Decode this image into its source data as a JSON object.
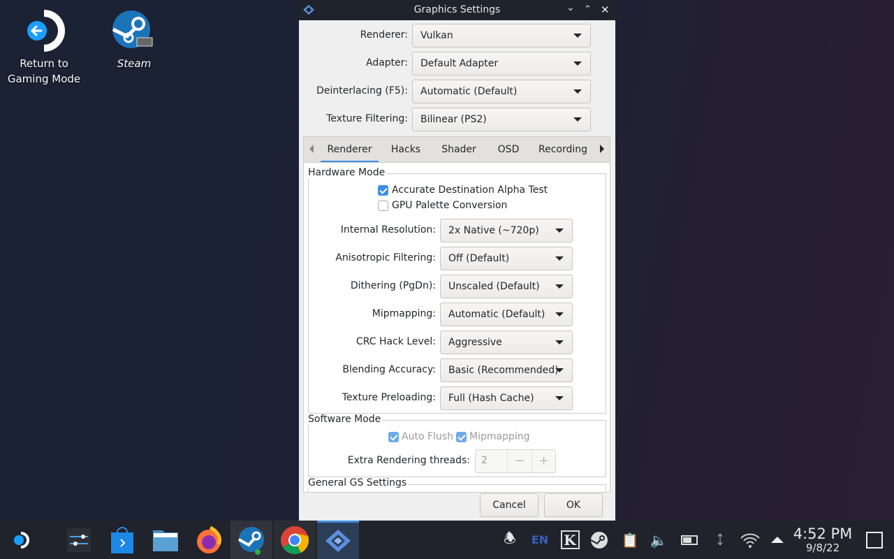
{
  "desktop": {
    "icons": [
      {
        "label_line1": "Return to",
        "label_line2": "Gaming Mode",
        "icon": "return-gaming-mode-icon"
      },
      {
        "label_line1": "Steam",
        "icon": "steam-icon"
      }
    ]
  },
  "window": {
    "title": "Graphics Settings",
    "app_icon": "pcsx2-icon",
    "controls": [
      "minimize-icon",
      "maximize-icon",
      "close-icon"
    ],
    "top_fields": [
      {
        "label": "Renderer:",
        "value": "Vulkan"
      },
      {
        "label": "Adapter:",
        "value": "Default Adapter"
      },
      {
        "label": "Deinterlacing (F5):",
        "value": "Automatic (Default)"
      },
      {
        "label": "Texture Filtering:",
        "value": "Bilinear (PS2)"
      }
    ],
    "tabs": [
      {
        "label": "Renderer",
        "active": true
      },
      {
        "label": "Hacks"
      },
      {
        "label": "Shader"
      },
      {
        "label": "OSD"
      },
      {
        "label": "Recording"
      }
    ],
    "hardware_mode": {
      "title": "Hardware Mode",
      "checkboxes": [
        {
          "label": "Accurate Destination Alpha Test",
          "checked": true
        },
        {
          "label": "GPU Palette Conversion",
          "checked": false
        }
      ],
      "fields": [
        {
          "label": "Internal Resolution:",
          "value": "2x Native (~720p)"
        },
        {
          "label": "Anisotropic Filtering:",
          "value": "Off (Default)"
        },
        {
          "label": "Dithering (PgDn):",
          "value": "Unscaled (Default)"
        },
        {
          "label": "Mipmapping:",
          "value": "Automatic (Default)"
        },
        {
          "label": "CRC Hack Level:",
          "value": "Aggressive"
        },
        {
          "label": "Blending Accuracy:",
          "value": "Basic (Recommended)"
        },
        {
          "label": "Texture Preloading:",
          "value": "Full (Hash Cache)"
        }
      ]
    },
    "software_mode": {
      "title": "Software Mode",
      "checkboxes": [
        {
          "label": "Auto Flush",
          "checked": true,
          "enabled": false
        },
        {
          "label": "Mipmapping",
          "checked": true,
          "enabled": false
        }
      ],
      "threads_label": "Extra Rendering threads:",
      "threads_value": "2",
      "minus": "−",
      "plus": "+"
    },
    "general_gs_title": "General GS Settings",
    "buttons": {
      "cancel": "Cancel",
      "ok": "OK"
    },
    "accent": "#3d8ee5"
  },
  "taskbar": {
    "apps": [
      "steam-deck-launcher-icon",
      "system-settings-icon",
      "discover-store-icon",
      "file-manager-icon",
      "firefox-icon",
      "steam-icon",
      "chrome-icon",
      "pcsx2-icon"
    ],
    "tray": {
      "language": "EN",
      "time": "4:52 PM",
      "date": "9/8/22"
    }
  }
}
